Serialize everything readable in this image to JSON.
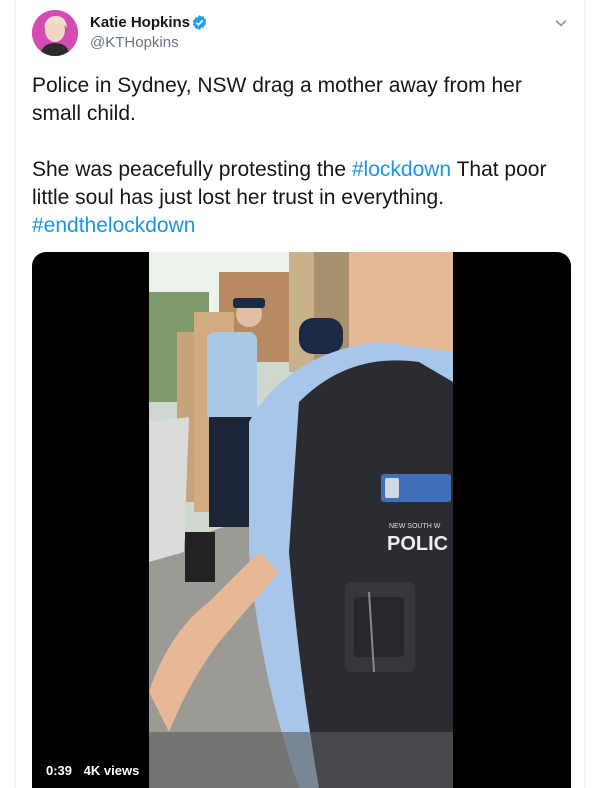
{
  "tweet": {
    "author": {
      "display_name": "Katie Hopkins",
      "handle": "@KTHopkins",
      "verified_icon": "verified-badge-icon"
    },
    "text_line1": "Police in Sydney, NSW drag a mother away from her small child.",
    "text_line2_prefix": "She was peacefully protesting the ",
    "hashtag1": "#lockdown",
    "text_line2_suffix": " That poor little soul has just lost her trust in everything.",
    "hashtag2": "#endthelockdown",
    "media": {
      "duration": "0:39",
      "views": "4K views",
      "vest_label_small": "NEW SOUTH W",
      "vest_label_large": "POLIC"
    }
  },
  "colors": {
    "link": "#1b95e0",
    "verified": "#1da1f2",
    "handle": "#657786"
  }
}
